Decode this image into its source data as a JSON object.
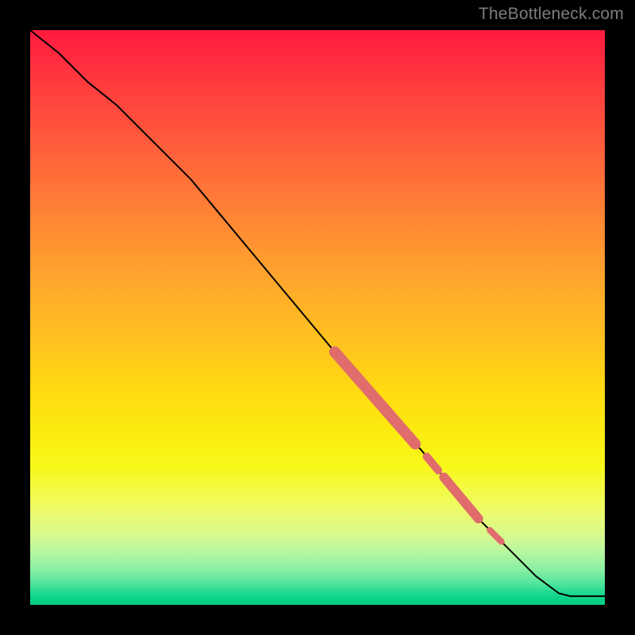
{
  "watermark": {
    "text": "TheBottleneck.com"
  },
  "colors": {
    "line": "#000000",
    "highlight": "#e06c6c",
    "gradient_top": "#ff1a3d",
    "gradient_bottom": "#04cc82"
  },
  "chart_data": {
    "type": "line",
    "title": "",
    "xlabel": "",
    "ylabel": "",
    "xlim": [
      0,
      100
    ],
    "ylim": [
      0,
      100
    ],
    "grid": false,
    "legend": false,
    "background": "vertical_gradient_red_to_green",
    "series": [
      {
        "name": "curve",
        "x": [
          0,
          5,
          10,
          15,
          20,
          24,
          28,
          33,
          38,
          43,
          48,
          53,
          58,
          63,
          68,
          73,
          78,
          83,
          88,
          92,
          94,
          100
        ],
        "y": [
          100,
          96,
          91,
          87,
          82,
          78,
          74,
          68,
          62,
          56,
          50,
          44,
          38,
          32,
          27,
          21,
          15,
          10,
          5,
          2,
          1.5,
          1.5
        ]
      }
    ],
    "highlights": [
      {
        "name": "segment_a",
        "x_start": 53,
        "x_end": 67,
        "width": 14
      },
      {
        "name": "dot_b",
        "x_start": 69,
        "x_end": 71,
        "width": 10
      },
      {
        "name": "segment_c",
        "x_start": 72,
        "x_end": 78,
        "width": 12
      },
      {
        "name": "dot_d",
        "x_start": 80,
        "x_end": 82,
        "width": 8
      }
    ]
  }
}
